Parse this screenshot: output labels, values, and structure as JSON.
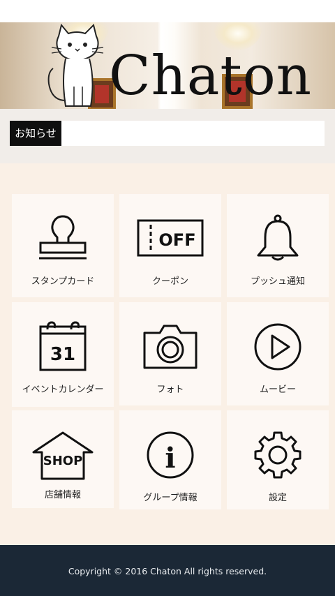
{
  "header": {
    "logo_text": "Chaton"
  },
  "notice": {
    "label": "お知らせ",
    "text": ""
  },
  "menu": {
    "items": [
      {
        "label": "スタンプカード",
        "icon": "stamp-icon"
      },
      {
        "label": "クーポン",
        "icon": "coupon-off-icon",
        "icon_text": "OFF"
      },
      {
        "label": "プッシュ通知",
        "icon": "bell-icon"
      },
      {
        "label": "イベントカレンダー",
        "icon": "calendar-icon",
        "icon_text": "31"
      },
      {
        "label": "フォト",
        "icon": "camera-icon"
      },
      {
        "label": "ムービー",
        "icon": "play-icon"
      },
      {
        "label": "店舗情報",
        "icon": "shop-icon",
        "icon_text": "SHOP"
      },
      {
        "label": "グループ情報",
        "icon": "info-icon",
        "icon_text": "i"
      },
      {
        "label": "設定",
        "icon": "gear-icon"
      }
    ]
  },
  "footer": {
    "copyright": "Copyright © 2016 Chaton All rights reserved."
  },
  "colors": {
    "footer_bg": "#1b2836",
    "grid_bg": "#faf0e6",
    "tile_bg": "#fdf8f4",
    "notice_label_bg": "#0f0f0f"
  }
}
